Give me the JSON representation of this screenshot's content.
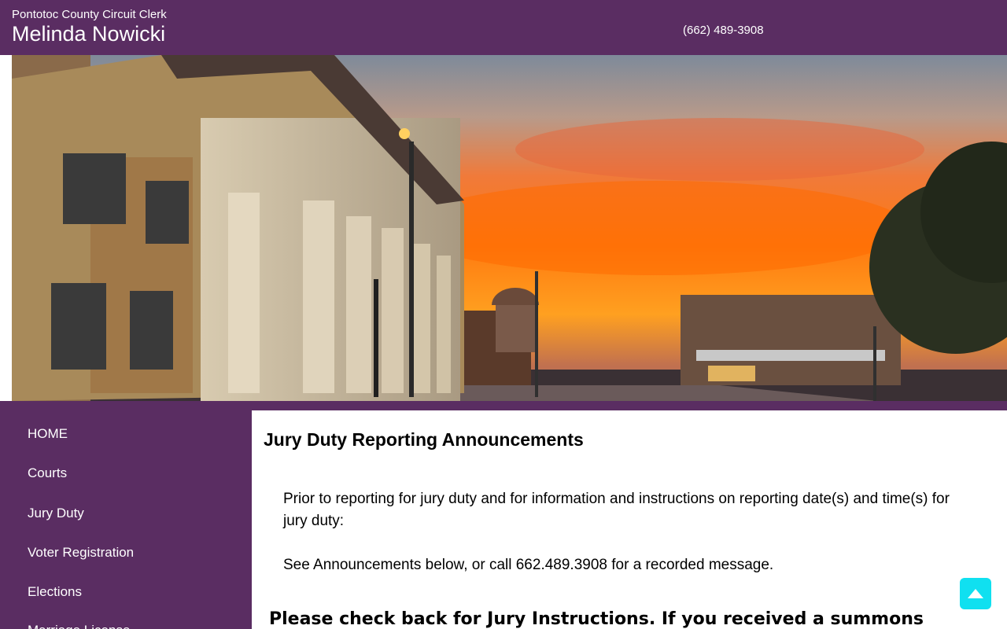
{
  "header": {
    "org": "Pontotoc County Circuit Clerk",
    "name": "Melinda Nowicki",
    "phone": "(662) 489-3908"
  },
  "colors": {
    "brand_purple": "#5a2d62",
    "accent_cyan": "#10e0f0"
  },
  "sidebar": {
    "items": [
      {
        "label": "HOME"
      },
      {
        "label": "Courts"
      },
      {
        "label": "Jury Duty"
      },
      {
        "label": "Voter Registration"
      },
      {
        "label": "Elections"
      },
      {
        "label": "Marriage License"
      }
    ]
  },
  "main": {
    "title": "Jury Duty Reporting Announcements",
    "paragraph1": "Prior to reporting for jury duty and for information and instructions on reporting date(s) and time(s) for jury duty:",
    "paragraph2": "See Announcements below, or call 662.489.3908 for a recorded message.",
    "notice": "Please check back for Jury Instructions. If you received a summons"
  },
  "icons": {
    "scroll_top": "chevron-up-icon"
  }
}
